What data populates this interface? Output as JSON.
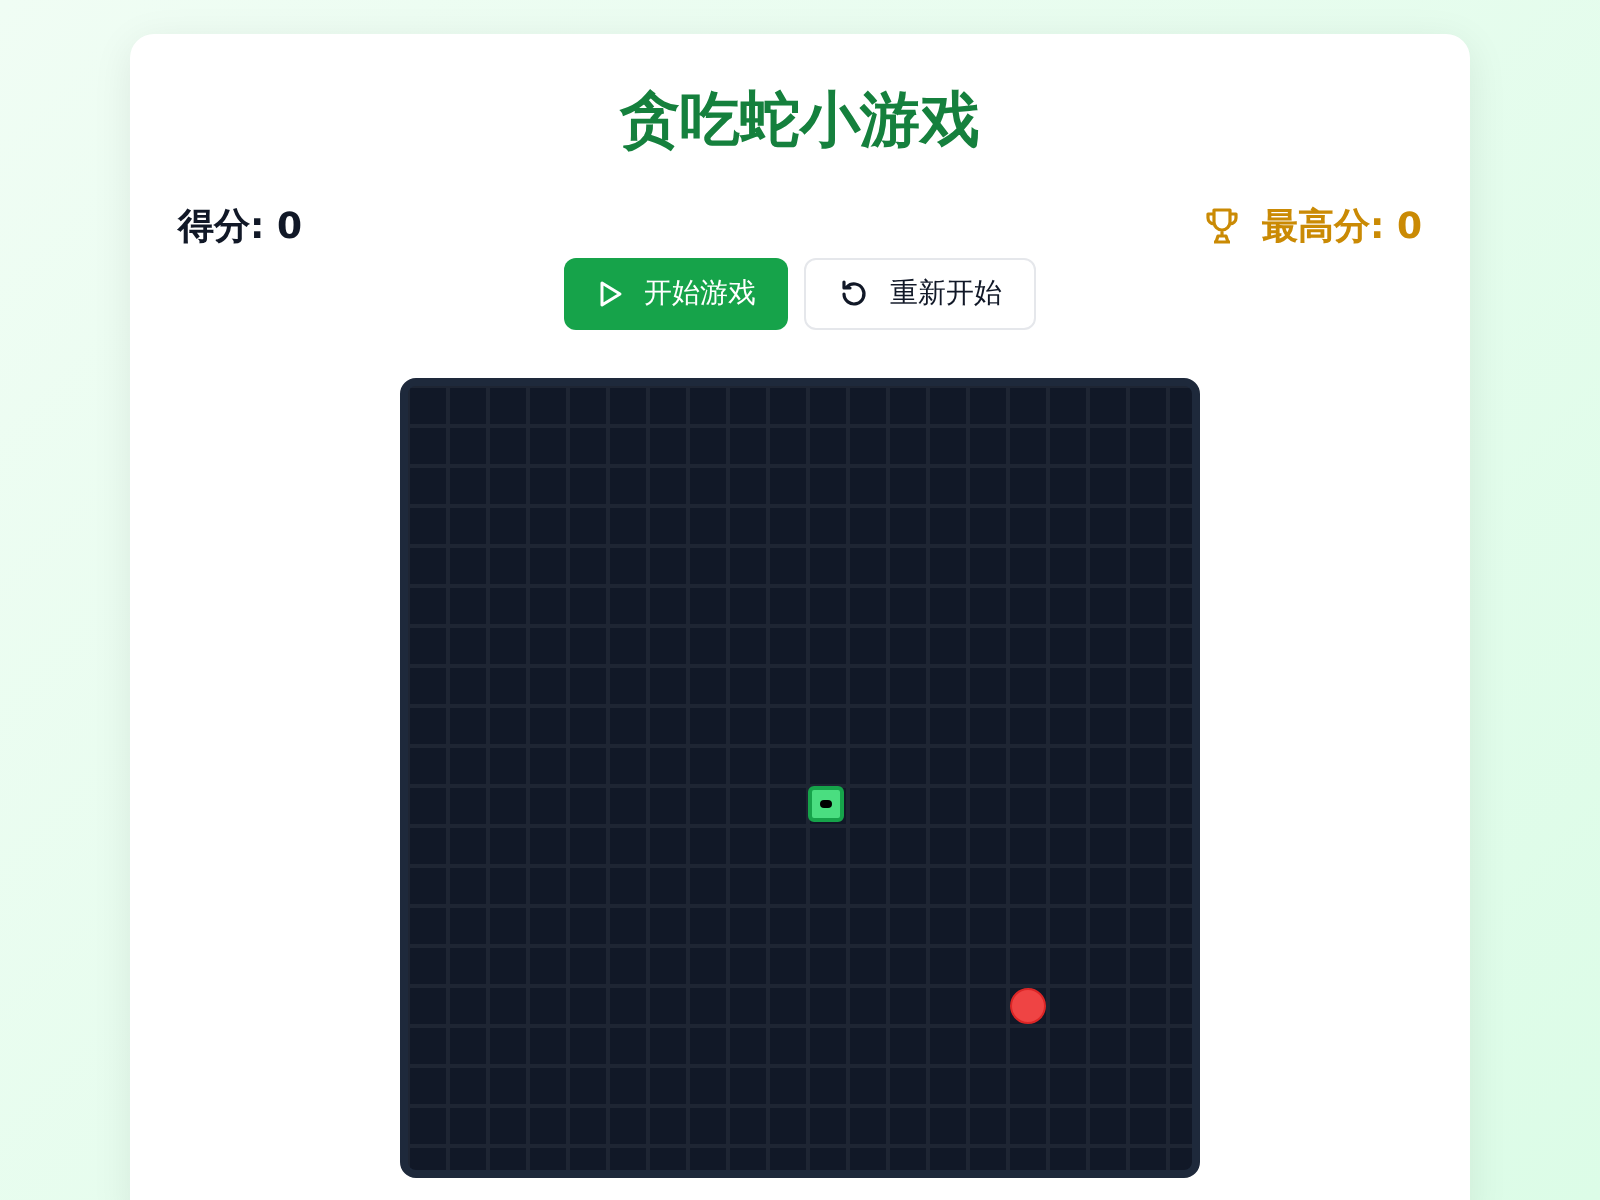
{
  "title": "贪吃蛇小游戏",
  "score": {
    "label": "得分: 0"
  },
  "high_score": {
    "label": "最高分: 0"
  },
  "buttons": [
    {
      "kind": "primary",
      "label": "开始游戏"
    },
    {
      "kind": "secondary",
      "label": "重新开始"
    }
  ]
}
